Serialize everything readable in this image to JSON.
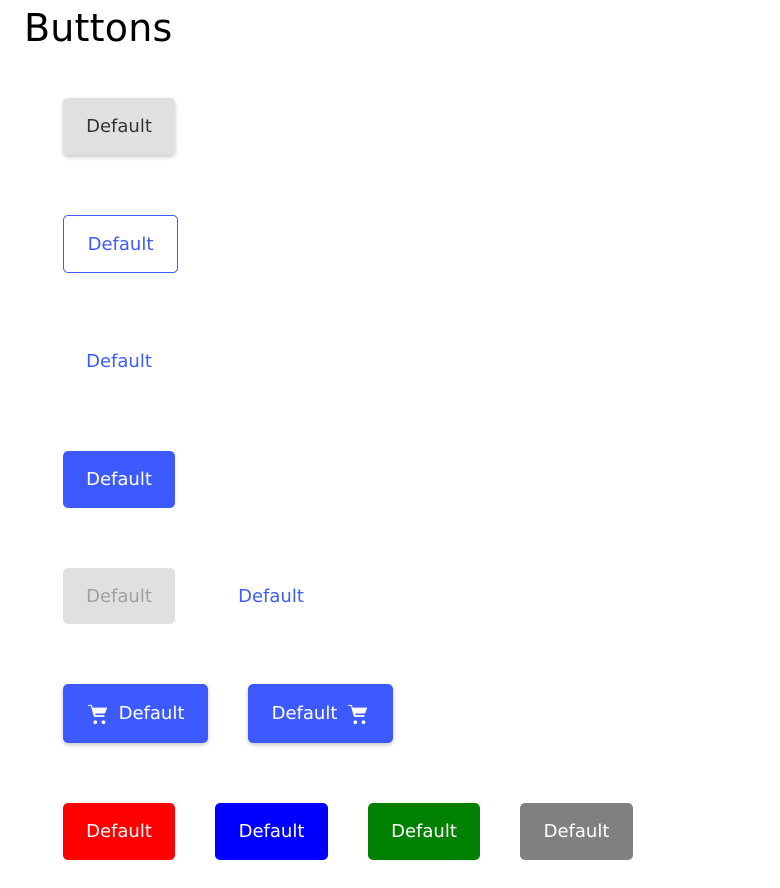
{
  "page": {
    "title": "Buttons"
  },
  "colors": {
    "primary": "#3d5afe",
    "default_bg": "#e0e0e0",
    "red": "#ff0000",
    "blue": "#0000ff",
    "green": "#008000",
    "gray": "#808080"
  },
  "buttons": {
    "default_label": "Default",
    "outlined_label": "Default",
    "text_label": "Default",
    "primary_label": "Default",
    "disabled_label": "Default",
    "disabled_text_label": "Default",
    "cart_start_label": "Default",
    "cart_end_label": "Default",
    "red_label": "Default",
    "blue_label": "Default",
    "green_label": "Default",
    "gray_label": "Default"
  },
  "icons": {
    "cart": "shopping-cart-icon"
  }
}
